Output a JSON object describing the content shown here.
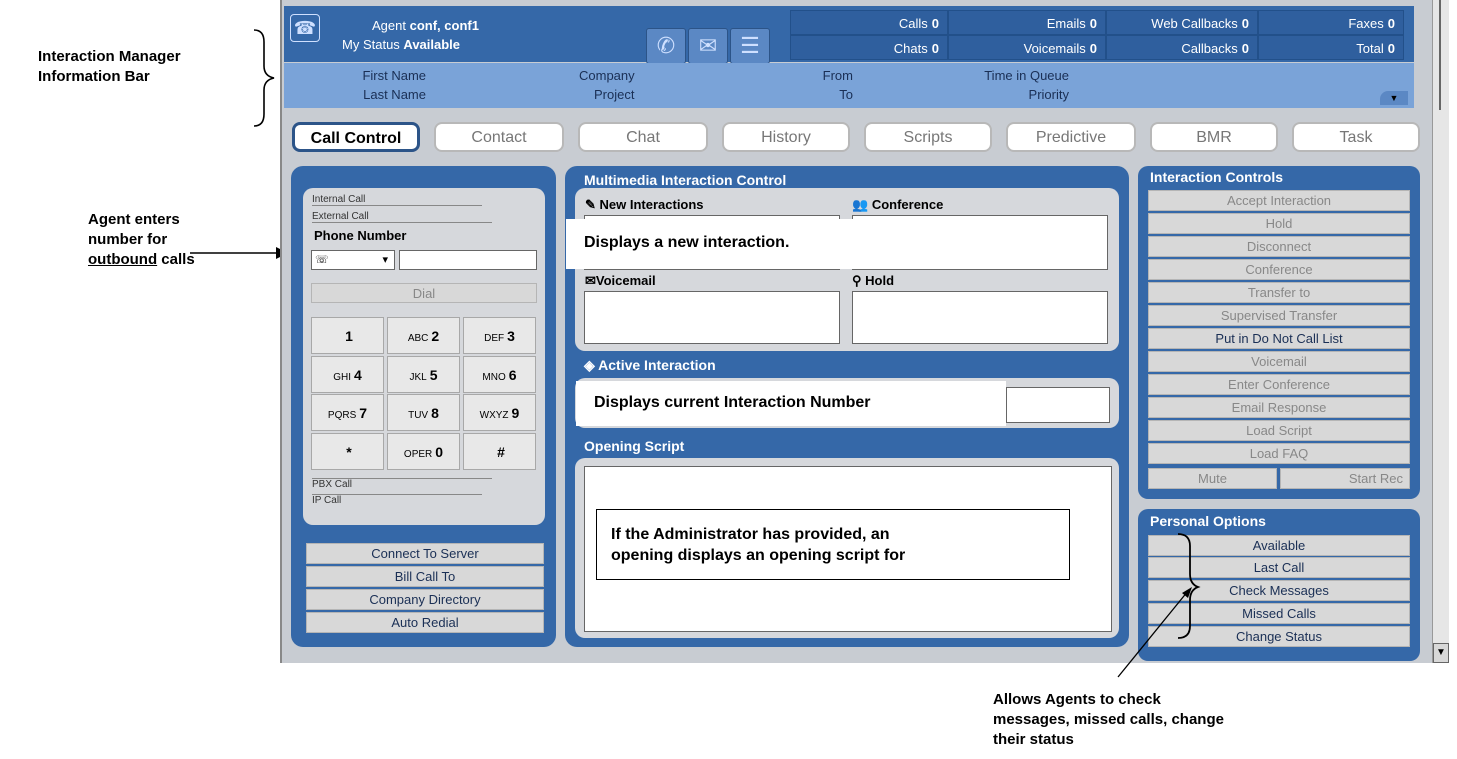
{
  "annotations": {
    "info_bar": [
      "Interaction Manager",
      "Information Bar"
    ],
    "agent_enters": [
      "Agent enters",
      "number for",
      "outbound",
      " calls"
    ],
    "allows": [
      "Allows Agents to check",
      "messages, missed calls, change",
      "their status"
    ]
  },
  "infobar": {
    "agent_label": "Agent",
    "agent_value": "conf, conf1",
    "status_label": "My Status",
    "status_value": "Available",
    "counters": [
      {
        "label": "Calls",
        "value": "0"
      },
      {
        "label": "Emails",
        "value": "0"
      },
      {
        "label": "Web Callbacks",
        "value": "0"
      },
      {
        "label": "Faxes",
        "value": "0"
      },
      {
        "label": "Chats",
        "value": "0"
      },
      {
        "label": "Voicemails",
        "value": "0"
      },
      {
        "label": "Callbacks",
        "value": "0"
      },
      {
        "label": "Total",
        "value": "0"
      }
    ],
    "fields": [
      "First Name",
      "Last Name",
      "Company",
      "Project",
      "From",
      "To",
      "Time in Queue",
      "Priority"
    ]
  },
  "tabs": [
    "Call Control",
    "Contact",
    "Chat",
    "History",
    "Scripts",
    "Predictive",
    "BMR",
    "Task"
  ],
  "left": {
    "tab_internal": "Internal Call",
    "tab_external": "External Call",
    "phone_label": "Phone Number",
    "dial": "Dial",
    "keys": [
      {
        "sub": "",
        "main": "1"
      },
      {
        "sub": "ABC",
        "main": "2"
      },
      {
        "sub": "DEF",
        "main": "3"
      },
      {
        "sub": "GHI",
        "main": "4"
      },
      {
        "sub": "JKL",
        "main": "5"
      },
      {
        "sub": "MNO",
        "main": "6"
      },
      {
        "sub": "PQRS",
        "main": "7"
      },
      {
        "sub": "TUV",
        "main": "8"
      },
      {
        "sub": "WXYZ",
        "main": "9"
      },
      {
        "sub": "",
        "main": "*"
      },
      {
        "sub": "OPER",
        "main": "0"
      },
      {
        "sub": "",
        "main": "#"
      }
    ],
    "tab_pbx": "PBX Call",
    "tab_ip": "IP Call",
    "buttons": [
      "Connect To Server",
      "Bill Call To",
      "Company Directory",
      "Auto Redial"
    ]
  },
  "center": {
    "title": "Multimedia Interaction Control",
    "new_interactions": "New Interactions",
    "conference": "Conference",
    "voicemail": "Voicemail",
    "hold": "Hold",
    "displays_new": "Displays a new interaction.",
    "active_interaction": "Active Interaction",
    "displays_current": "Displays current Interaction Number",
    "opening_script": "Opening Script",
    "opening_text": [
      "If the Administrator has provided, an",
      "opening displays an opening script for"
    ]
  },
  "right": {
    "controls_title": "Interaction Controls",
    "controls": [
      "Accept Interaction",
      "Hold",
      "Disconnect",
      "Conference",
      "Transfer to",
      "Supervised Transfer",
      "Put in Do Not Call List",
      "Voicemail",
      "Enter Conference",
      "Email Response",
      "Load Script",
      "Load FAQ"
    ],
    "mute": "Mute",
    "start_rec": "Start Rec",
    "personal_title": "Personal Options",
    "personal": [
      "Available",
      "Last Call",
      "Check Messages",
      "Missed Calls",
      "Change Status"
    ]
  },
  "colors": {
    "panel": "#3568a8",
    "infobar_light": "#7aa3d8",
    "background": "#c8ccd2"
  }
}
